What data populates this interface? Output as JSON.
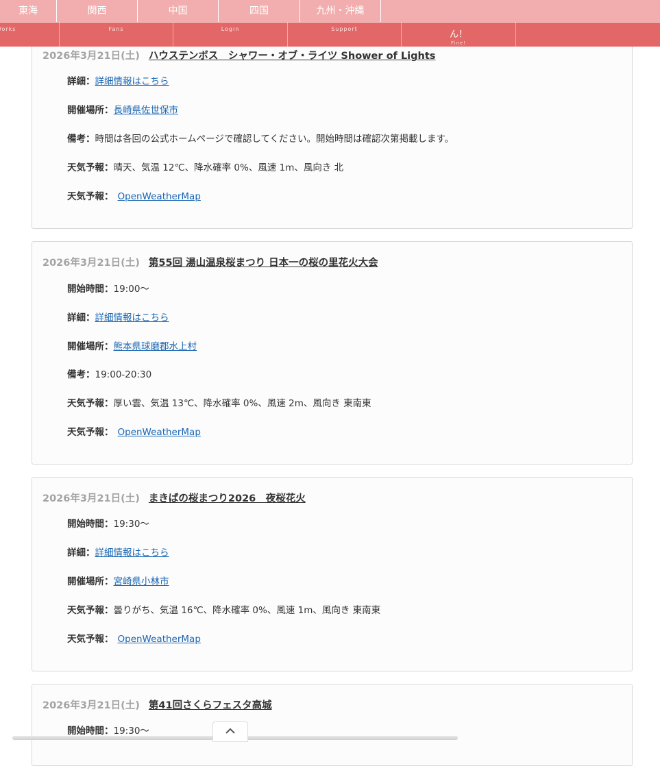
{
  "region_nav": [
    "東海",
    "関西",
    "中国",
    "四国",
    "九州・沖縄"
  ],
  "menu_nav": [
    {
      "sub": "Works",
      "main": "",
      "sub2": ""
    },
    {
      "sub": "Fans",
      "main": "",
      "sub2": ""
    },
    {
      "sub": "Login",
      "main": "",
      "sub2": ""
    },
    {
      "sub": "Support",
      "main": "",
      "sub2": ""
    },
    {
      "sub": "",
      "main": "ん！",
      "sub2": "Fine!"
    },
    {
      "sub": "",
      "main": "",
      "sub2": ""
    }
  ],
  "labels": {
    "start": "開始時間：",
    "detail": "詳細：",
    "venue": "開催場所：",
    "note": "備考：",
    "weather": "天気予報：",
    "weather_link": "天気予報：",
    "detail_link": "詳細情報はこちら",
    "owm": "OpenWeatherMap"
  },
  "events": [
    {
      "date": "2026年3月21日(土)",
      "title": "ハウステンボス　シャワー・オブ・ライツ Shower of Lights",
      "venue": "長崎県佐世保市",
      "note": "時間は各回の公式ホームページで確認してください。開始時間は確認次第掲載します。",
      "weather": "晴天、気温 12℃、降水確率 0%、風速 1m、風向き 北"
    },
    {
      "date": "2026年3月21日(土)",
      "title": "第55回 湯山温泉桜まつり 日本一の桜の里花火大会",
      "start": "19:00～",
      "venue": "熊本県球磨郡水上村",
      "note": "19:00-20:30",
      "weather": "厚い雲、気温 13℃、降水確率 0%、風速 2m、風向き 東南東"
    },
    {
      "date": "2026年3月21日(土)",
      "title": "まきばの桜まつり2026　夜桜花火",
      "start": "19:30～",
      "venue": "宮崎県小林市",
      "weather": "曇りがち、気温 16℃、降水確率 0%、風速 1m、風向き 東南東"
    },
    {
      "date": "2026年3月21日(土)",
      "title": "第41回さくらフェスタ高城",
      "start": "19:30～"
    }
  ]
}
